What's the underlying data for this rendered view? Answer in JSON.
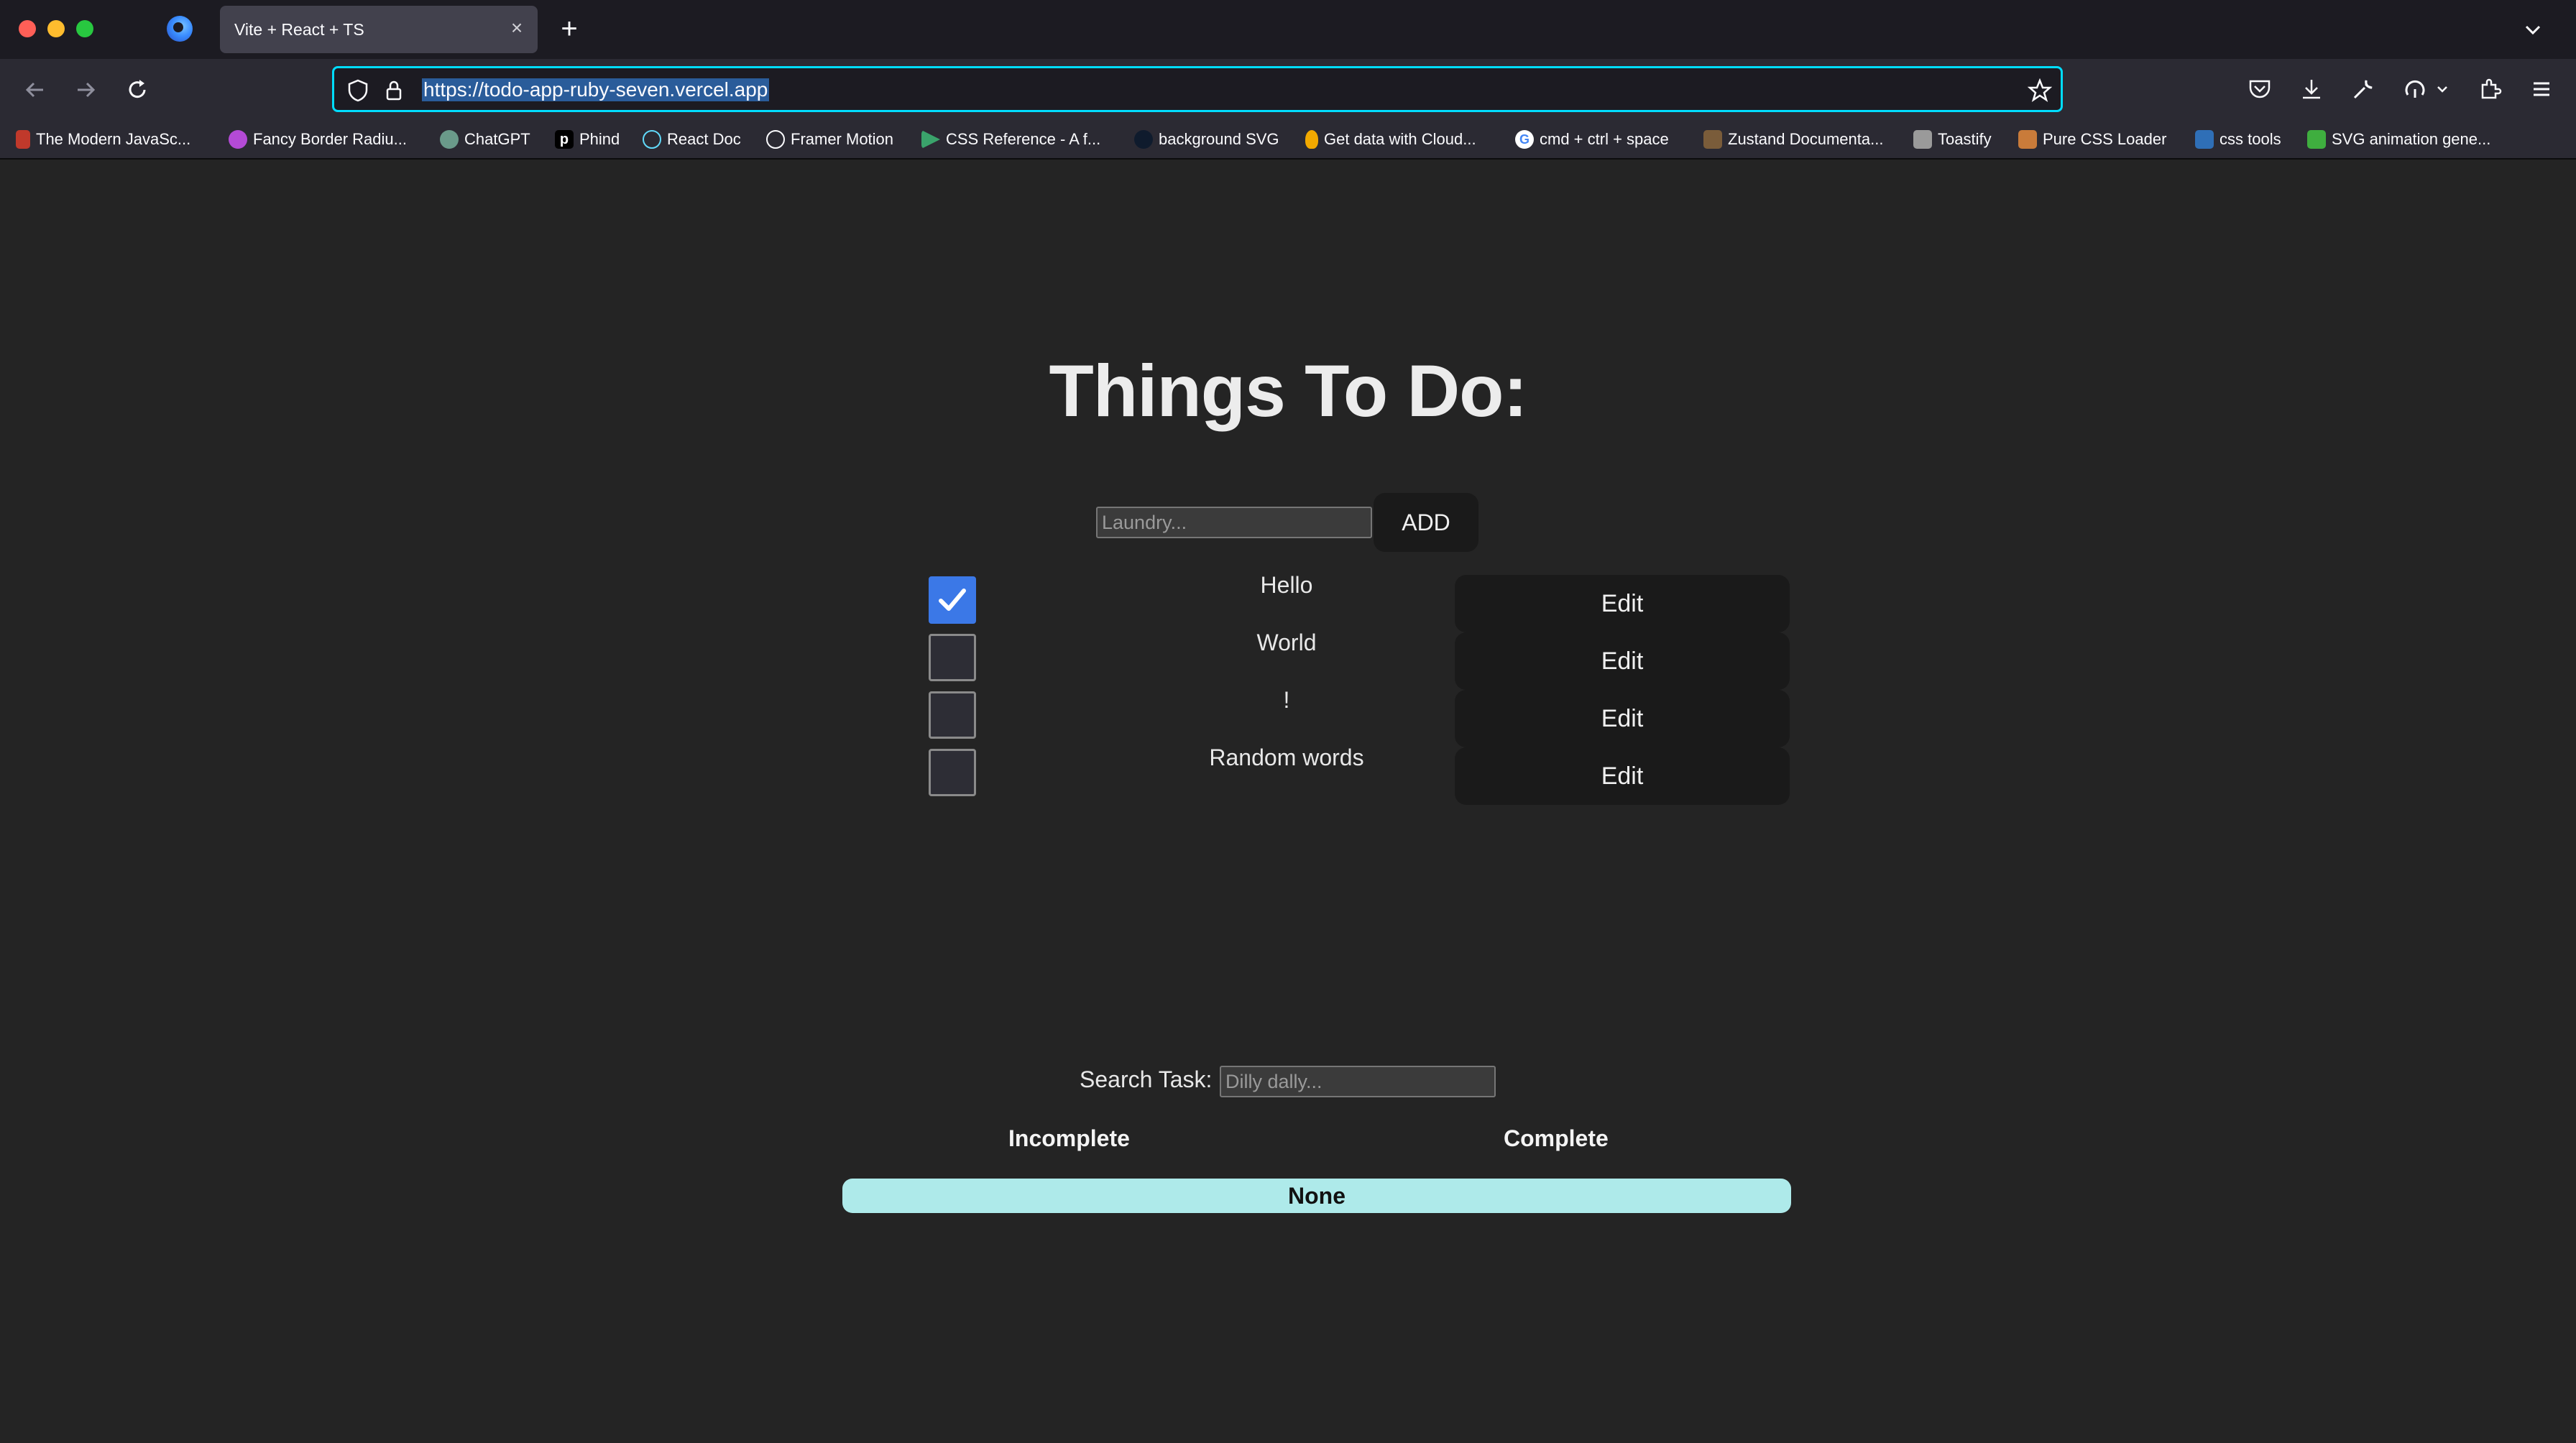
{
  "browser": {
    "tab_title": "Vite + React + TS",
    "tab_close": "×",
    "new_tab": "+",
    "url": "https://todo-app-ruby-seven.vercel.app",
    "bookmarks": [
      {
        "label": "The Modern JavaSc...",
        "color": "#c0392b"
      },
      {
        "label": "Fancy Border Radiu...",
        "color": "#b44ad6"
      },
      {
        "label": "ChatGPT",
        "color": "#6a9a8a"
      },
      {
        "label": "Phind",
        "color": "#000000"
      },
      {
        "label": "React Doc",
        "color": "#2f6f8f"
      },
      {
        "label": "Framer Motion",
        "color": "#555555"
      },
      {
        "label": "CSS Reference - A f...",
        "color": "#3aa36b"
      },
      {
        "label": "background SVG",
        "color": "#0f1b2d"
      },
      {
        "label": "Get data with Cloud...",
        "color": "#f2a900"
      },
      {
        "label": "cmd + ctrl + space",
        "color": "#ffffff"
      },
      {
        "label": "Zustand Documenta...",
        "color": "#7a5c3a"
      },
      {
        "label": "Toastify",
        "color": "#9a9a9a"
      },
      {
        "label": "Pure CSS Loader",
        "color": "#c97b3a"
      },
      {
        "label": "css tools",
        "color": "#2f6fb7"
      },
      {
        "label": "SVG animation gene...",
        "color": "#3fae3f"
      }
    ]
  },
  "app": {
    "title": "Things To Do:",
    "new_task_placeholder": "Laundry...",
    "add_label": "ADD",
    "todos": [
      {
        "text": "Hello",
        "done": true,
        "edit_label": "Edit"
      },
      {
        "text": "World",
        "done": false,
        "edit_label": "Edit"
      },
      {
        "text": "!",
        "done": false,
        "edit_label": "Edit"
      },
      {
        "text": "Random words",
        "done": false,
        "edit_label": "Edit"
      }
    ],
    "search_label": "Search Task:",
    "search_placeholder": "Dilly dally...",
    "filters": {
      "incomplete": "Incomplete",
      "complete": "Complete",
      "none": "None"
    },
    "colors": {
      "accent_check": "#3b78e7",
      "none_bar": "#aeeaea"
    }
  }
}
